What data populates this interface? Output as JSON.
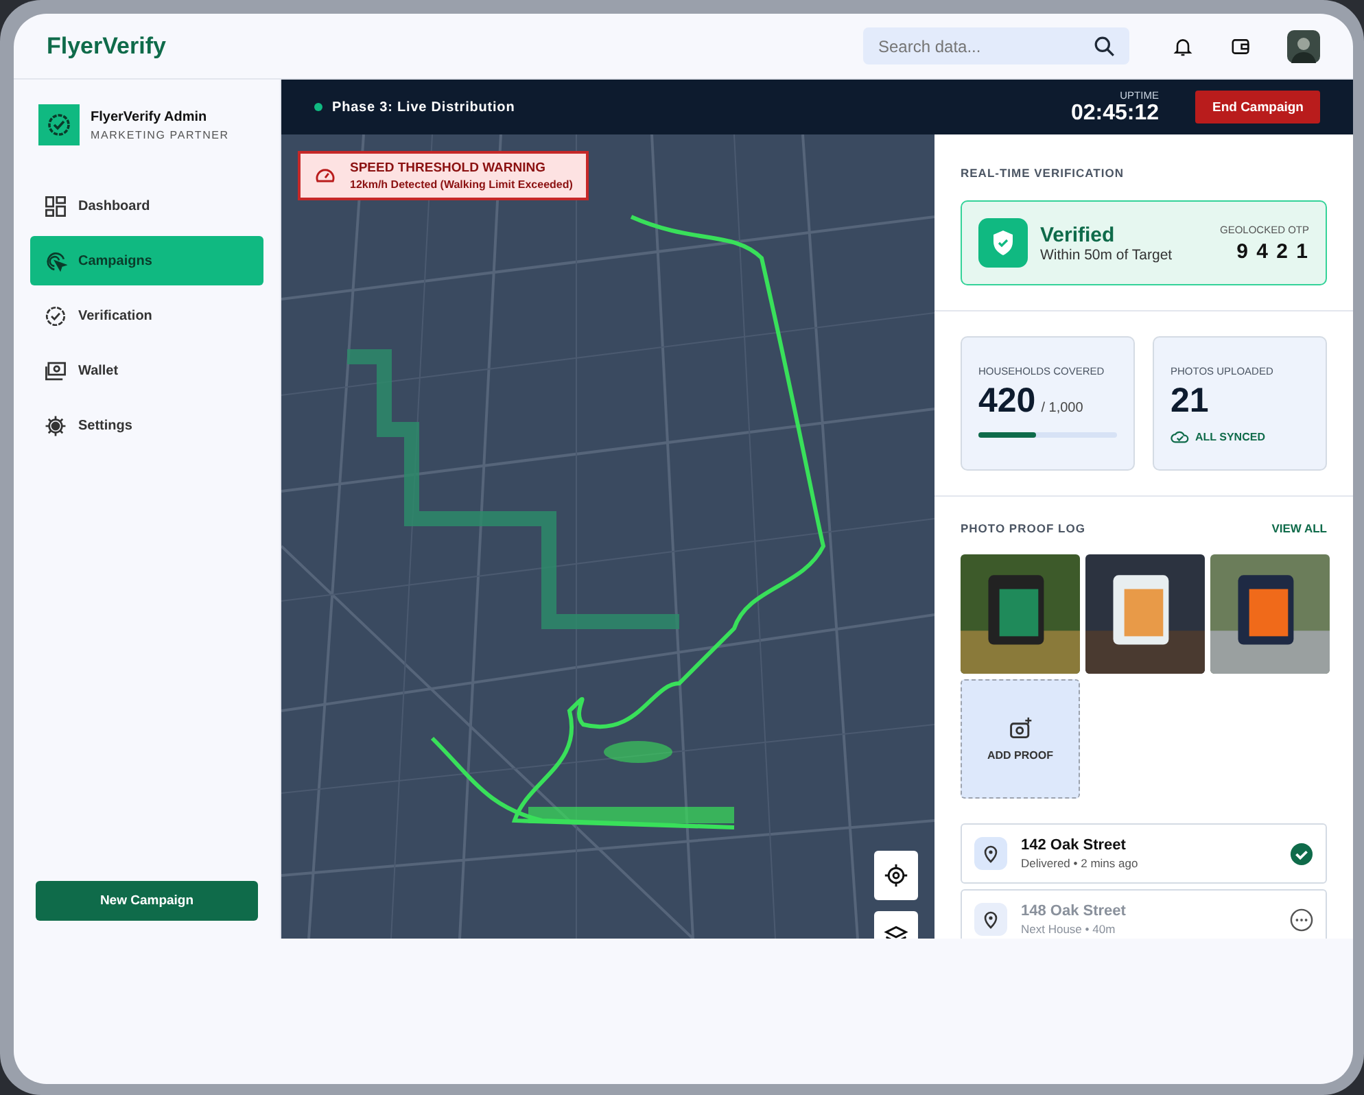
{
  "header": {
    "logo": "FlyerVerify",
    "search": {
      "placeholder": "Search data..."
    }
  },
  "sidebar": {
    "profile": {
      "name": "FlyerVerify Admin",
      "role": "MARKETING PARTNER"
    },
    "items": [
      {
        "label": "Dashboard",
        "kind": "grid",
        "selected": false
      },
      {
        "label": "Campaigns",
        "kind": "target",
        "selected": true
      },
      {
        "label": "Verification",
        "kind": "badge",
        "selected": false
      },
      {
        "label": "Wallet",
        "kind": "wallet",
        "selected": false
      },
      {
        "label": "Settings",
        "kind": "gear",
        "selected": false
      }
    ],
    "new_button": "New Campaign"
  },
  "status_bar": {
    "phase": "Phase 3: Live Distribution",
    "live": true,
    "uptime_label": "UPTIME",
    "uptime": "02:45:12",
    "end_button": "End Campaign"
  },
  "warning": {
    "title": "SPEED THRESHOLD WARNING",
    "detail": "12km/h Detected (Walking Limit Exceeded)"
  },
  "verification": {
    "heading": "REAL-TIME VERIFICATION",
    "verified": true,
    "status": "Verified",
    "detail": "Within 50m of Target",
    "otp_label": "GEOLOCKED OTP",
    "otp": "9 4 2 1"
  },
  "stats": [
    {
      "kind": "progress",
      "label": "HOUSEHOLDS COVERED",
      "value": "420",
      "total": "/ 1,000",
      "level": 0.42
    },
    {
      "kind": "sync",
      "label": "PHOTOS UPLOADED",
      "value": "21",
      "note": "ALL SYNCED"
    }
  ],
  "photo_log": {
    "heading": "PHOTO PROOF LOG",
    "link": "VIEW ALL",
    "add": "ADD PROOF"
  },
  "addresses": [
    {
      "street": "142 Oak Street",
      "detail": "Delivered • 2 mins ago",
      "done": true
    },
    {
      "street": "148 Oak Street",
      "detail": "Next House • 40m",
      "done": false
    }
  ]
}
